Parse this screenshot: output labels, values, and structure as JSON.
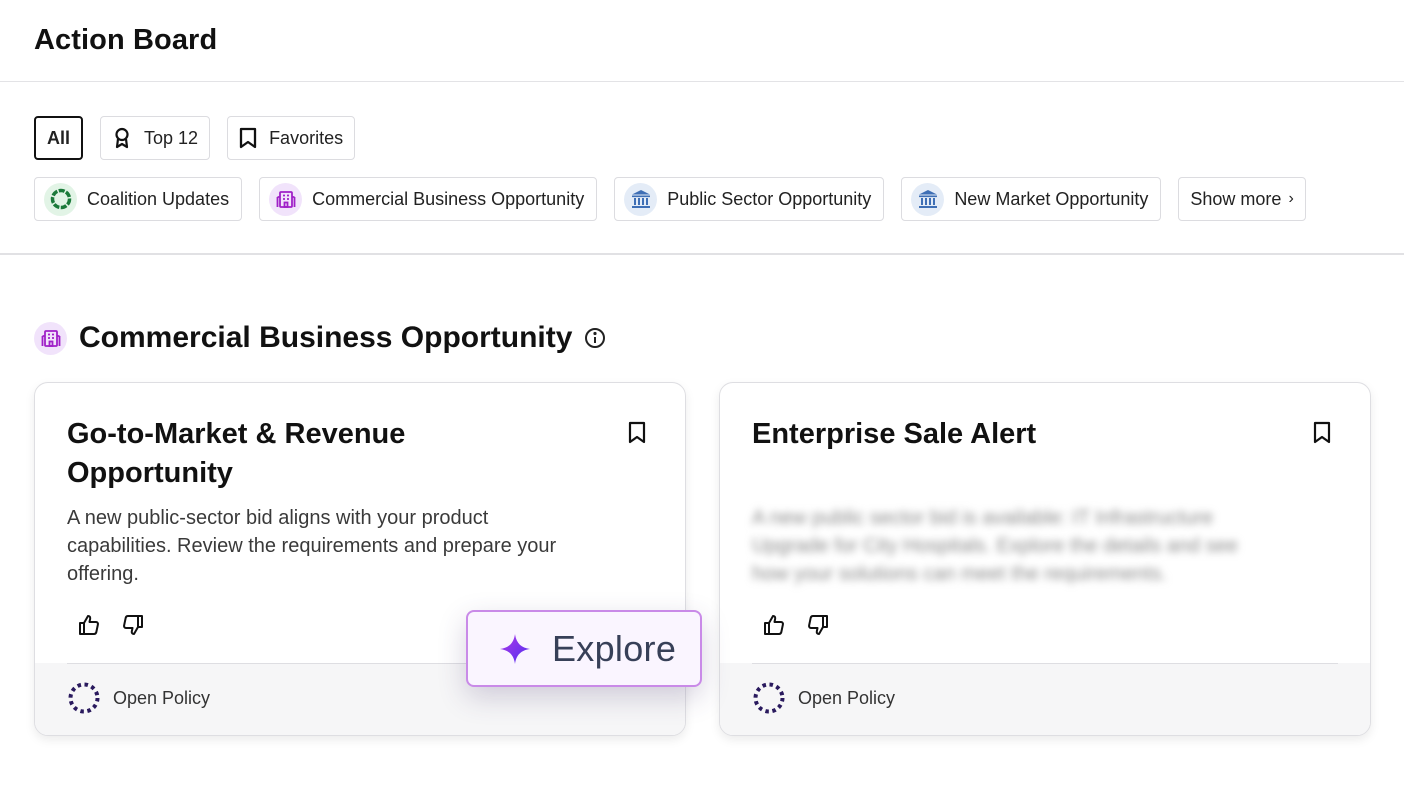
{
  "header": {
    "title": "Action Board"
  },
  "filters": {
    "primary": [
      {
        "label": "All",
        "active": true
      },
      {
        "label": "Top 12",
        "icon": "award-ribbon-icon"
      },
      {
        "label": "Favorites",
        "icon": "bookmark-icon"
      }
    ],
    "categories": [
      {
        "label": "Coalition Updates",
        "icon": "ring-icon",
        "color": "#1b7a3a"
      },
      {
        "label": "Commercial Business Opportunity",
        "icon": "building-icon",
        "color": "#a020c8"
      },
      {
        "label": "Public Sector Opportunity",
        "icon": "bank-icon",
        "color": "#3f6fb5"
      },
      {
        "label": "New Market Opportunity",
        "icon": "bank-icon",
        "color": "#3f6fb5"
      }
    ],
    "show_more": "Show more",
    "show_more_chevron": "›"
  },
  "section": {
    "title": "Commercial Business Opportunity",
    "icon": "building-icon",
    "info_icon": "info-icon"
  },
  "cards": [
    {
      "title": "Go-to-Market & Revenue Opportunity",
      "description": "A new public-sector bid aligns with your product capabilities. Review the requirements and prepare your offering.",
      "org": "Open Policy"
    },
    {
      "title": "Enterprise Sale Alert",
      "description": "A new public sector bid is available: IT Infrastructure Upgrade for City Hospitals. Explore the details and see how your solutions can meet the requirements.",
      "org": "Open Policy",
      "description_blurred": true
    }
  ],
  "explore": {
    "label": "Explore",
    "icon": "sparkle-icon"
  },
  "colors": {
    "accent": "#a020c8",
    "explore_border": "#c98ae8",
    "sparkle": "#7b2ff0"
  }
}
